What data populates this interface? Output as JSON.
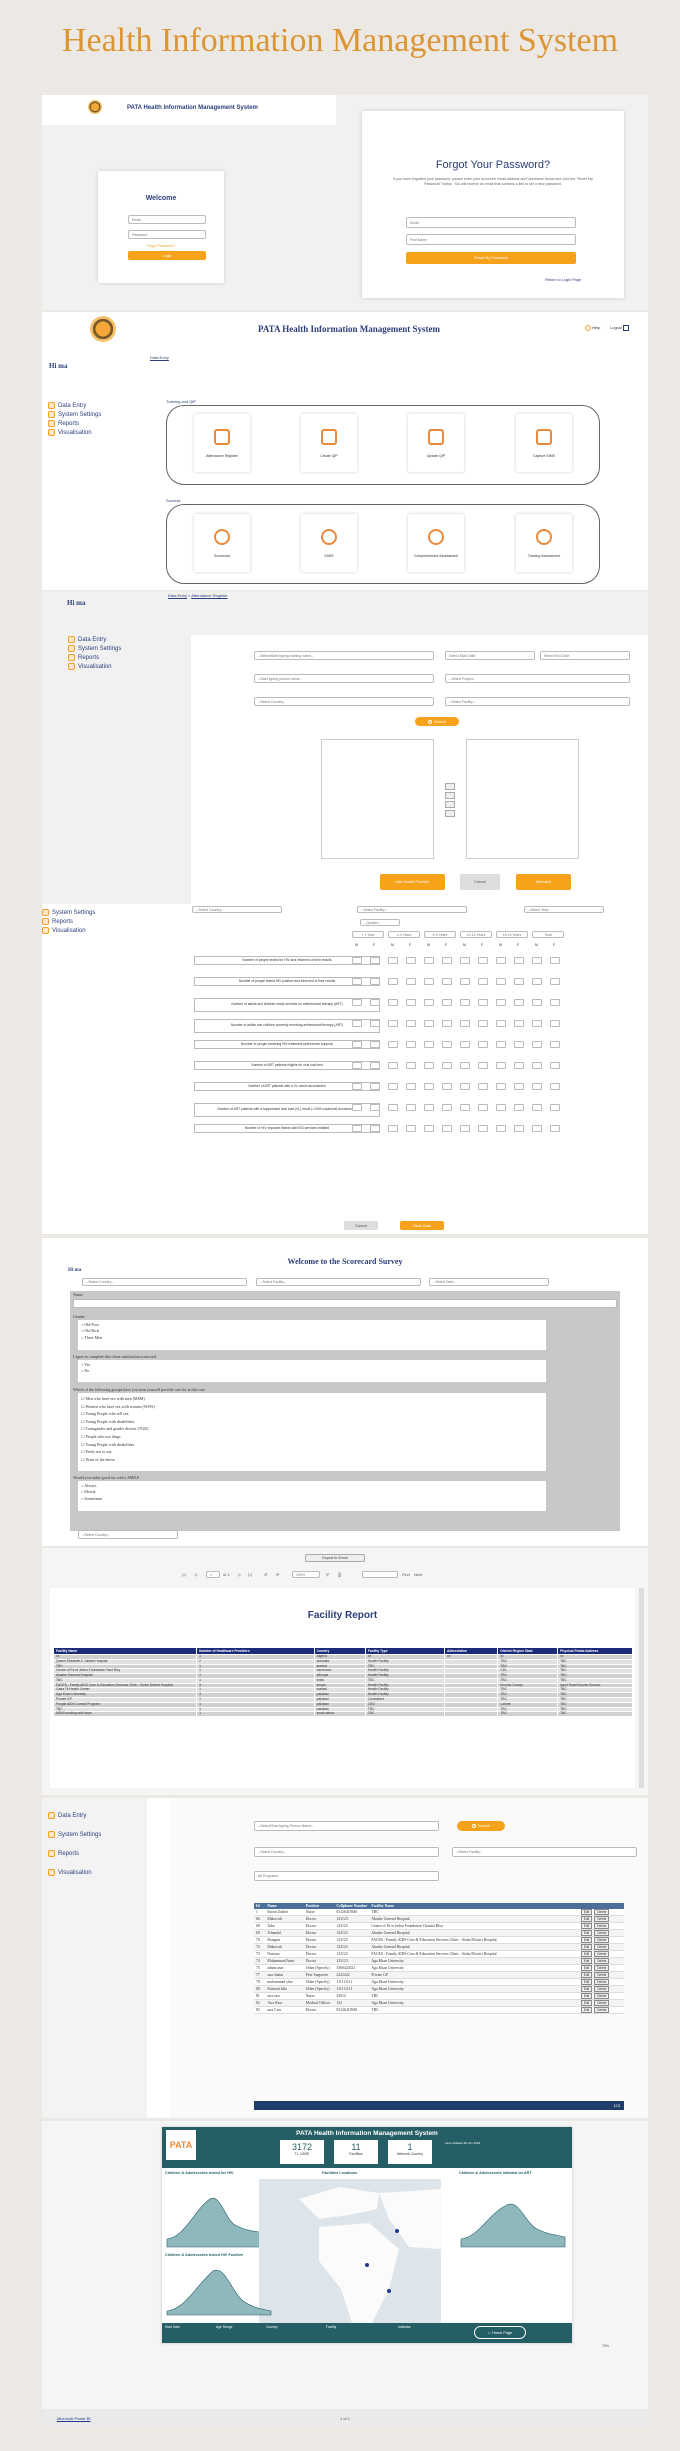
{
  "banner": {
    "title": "Health Information Management System"
  },
  "login": {
    "app_title": "PATA Health Information Management System",
    "welcome": "Welcome",
    "email_placeholder": "Email",
    "password_placeholder": "Password",
    "forgot_link": "Forgot Password?",
    "login_button": "Login"
  },
  "forgot": {
    "title": "Forgot Your Password?",
    "description": "If you have forgotten your password, please enter your account's email address and Username below and click the \"Reset My Password\" button. You will receive an email that contains a link to set a new password.",
    "email_placeholder": "Email",
    "firstname_placeholder": "First Name",
    "reset_button": "Reset My Password",
    "back_link": "Return to Login Page"
  },
  "dashboard": {
    "app_title": "PATA Health Information Management System",
    "greeting": "Hi ma",
    "breadcrumb": "Data Entry",
    "help": "Help",
    "logout": "Logout",
    "section_training": "Training and QIP",
    "section_surveys": "Surveys",
    "tiles_training": [
      "Attendance Register",
      "Create QIP",
      "Update QIP",
      "Capture SIMS"
    ],
    "tiles_surveys": [
      "Scorecard",
      "SARS",
      "Comprehensive Assessment",
      "Training Assessment"
    ]
  },
  "sidebar": {
    "items": [
      "Data Entry",
      "System Settings",
      "Reports",
      "Visualisation"
    ]
  },
  "attendance": {
    "greeting": "Hi ma",
    "breadcrumb_home": "Data Entry",
    "breadcrumb_sep": " > ",
    "breadcrumb_current": "Attendance Register",
    "training_placeholder": "--Select/Start typing training name--",
    "start_date": "Select Start Date",
    "end_date": "Select End Date",
    "hp_placeholder": "--Start typing person name--",
    "project_placeholder": "--Select Project--",
    "country_placeholder": "--Select Country--",
    "facility_placeholder": "--Select Facility--",
    "search_button": "Search",
    "add_button": "Add Health Provider",
    "cancel_button": "Cancel",
    "attended_button": "Attended"
  },
  "sims": {
    "country_placeholder": "--Select Country--",
    "facility_placeholder": "--Select Facility--",
    "year_placeholder": "--Select Year--",
    "quarter_placeholder": "--Quarter--",
    "age_groups": [
      "< 1 Year",
      "1-4 Years",
      "5-9 Years",
      "10-14 Years",
      "15-19 Years",
      "Total"
    ],
    "sexes": [
      "M",
      "F",
      "M",
      "F",
      "M",
      "F",
      "M",
      "F",
      "M",
      "F",
      "M",
      "F"
    ],
    "indicators": [
      "Number of people tested for HIV and informed of their results",
      "Number of people tested HIV positive and informed of their results",
      "Number of adults and children newly enrolled on antiretroviral therapy (ART)",
      "Number of adults and children currently receiving antiretroviral therapy (ART)",
      "Number of people receiving HIV treatment (adherence support)",
      "Number of ART patients eligible for viral load test",
      "Number of ART patients with a VL result documented",
      "Number of ART patients with a suppressed viral load (VL) result (<1000 copies/ml) documented",
      "Number of HIV exposed infants with EID services initiated"
    ],
    "cancel_button": "Cancel",
    "save_button": "Save Data"
  },
  "scorecard": {
    "title": "Welcome to the Scorecard Survey",
    "greeting": "Hi ma",
    "country_placeholder": "--Select Country--",
    "facility_placeholder": "--Select Facility--",
    "date_placeholder": "--Select Date--",
    "q_name": "Name",
    "q_gender": "Gender",
    "gender_options": [
      "Old Poor",
      "Old Rich",
      "Three Men"
    ],
    "q_consent": "I agree to complete this client satisfaction scorecard",
    "consent_options": [
      "Yes",
      "No"
    ],
    "q_groups": "Which of the following groups have you seen yourself provide care for at this care",
    "group_options": [
      "Men who have sex with men (MSM)",
      "Women who have sex with women (WSW)",
      "Young People who sell sex",
      "Young People with disabilities",
      "Transgender and gender diverse (TGD)",
      "People who use drugs",
      "Young People with disabilities",
      "Pretty not to say",
      "None of the above"
    ],
    "q_rating": "Would you rather good ser with a SMILE",
    "rating_options": [
      "Always",
      "Mostly",
      "Sometimes"
    ],
    "country_bottom": "--Select Country--"
  },
  "report": {
    "export_button": "Export to Excel",
    "page_current": "1",
    "page_total": "of 1",
    "zoom": "100%",
    "find_placeholder": "Find",
    "next_label": "Next",
    "title": "Facility Report",
    "columns": [
      "Facility Name",
      "Number of Healthcare Providers",
      "Country",
      "Facility Type",
      "Abbreviation",
      "District Region State",
      "Physical Postal Address"
    ],
    "rows": [
      [
        "xx",
        "1",
        "Algeria",
        "xx",
        "xx",
        "xx",
        "xx"
      ],
      [
        "Queen Elizabeth II Jubilee Hospital",
        "2",
        "australia",
        "Health Facility",
        "",
        "TBC",
        "TBC"
      ],
      [
        "TBC",
        "1",
        "austria",
        "TBC",
        "",
        "TBC",
        "TBC"
      ],
      [
        "Centre of Fa et Jeden Foundation Sant Ricy",
        "1",
        "cameroon",
        "Health Facility",
        "",
        "CDL",
        "TBC"
      ],
      [
        "Akashe General Hospital",
        "1",
        "ethiopia",
        "Health Facility",
        "",
        "TBC",
        "TBC"
      ],
      [
        "TBC",
        "1",
        "india",
        "TBC",
        "",
        "TBC",
        "TBC"
      ],
      [
        "FACES - Family AIDS Care & Education Services Clinic - Sudar District Hospital",
        "3",
        "kenya",
        "Health Facility",
        "",
        "Kisumu County",
        "Agnit Road Kisumu Kisumu"
      ],
      [
        "Gada Tit Health Center",
        "1",
        "malawi",
        "Health Facility",
        "",
        "TBC",
        "TBC"
      ],
      [
        "Aga Khan University",
        "3",
        "pakistan",
        "Health Facility",
        "",
        "TBC",
        "TBC"
      ],
      [
        "Private GP",
        "1",
        "pakistan",
        "Consultant",
        "",
        "TBC",
        "TBC"
      ],
      [
        "Punjab AIDS Control Program",
        "1",
        "pakistan",
        "CBO",
        "",
        "Lahore",
        "TBC"
      ],
      [
        "TBC",
        "1",
        "pakistan",
        "TBC",
        "",
        "TBC",
        "TBC"
      ],
      [
        "MEMI working with boys",
        "1",
        "south africa",
        "TBC",
        "",
        "TBC",
        "TBC"
      ]
    ]
  },
  "providers": {
    "search_placeholder": "--Select/Start typing Person Name--",
    "search_button": "Search",
    "country_placeholder": "--Select Country--",
    "facility_placeholder": "--Select Facility--",
    "programs_placeholder": "All Programs",
    "columns": [
      "Id",
      "Name",
      "Position",
      "Cellphone Number",
      "Facility Name"
    ],
    "edit_label": "Edit",
    "delete_label": "Delete",
    "rows": [
      [
        "1",
        "Farzai Zulfiei",
        "Nurse",
        "03126415940",
        "TBC"
      ],
      [
        "66",
        "Makovuh",
        "Doctor",
        "123123",
        "Akashe General Hospital"
      ],
      [
        "68",
        "Tabo",
        "Doctor",
        "123123",
        "Centre of Fa et Jeden Foundation Chantal Biya"
      ],
      [
        "69",
        "Tshandal",
        "Doctor",
        "123123",
        "Akashe General Hospital"
      ],
      [
        "70",
        "Bongani",
        "Doctor",
        "123123",
        "FACES - Family AIDS Care & Education Services Clinic - Siaha District Hospital"
      ],
      [
        "72",
        "Makovuh",
        "Doctor",
        "123123",
        "Akashe General Hospital"
      ],
      [
        "73",
        "Nasruez",
        "Doctor",
        "123123",
        "FACES - Family AIDS Care & Education Services Clinic - Siaha District Hospital"
      ],
      [
        "74",
        "Muhammad Amir",
        "Doctor",
        "123123",
        "Aga Khan University"
      ],
      [
        "75",
        "adnan asar",
        "Other (Specify)",
        "3360424321",
        "Aga Khan University"
      ],
      [
        "77",
        "sasr shaim",
        "Peer Supporter",
        "2222222",
        "Private GP"
      ],
      [
        "78",
        "muhammad ybiz",
        "Other (Specify)",
        "111111111",
        "Aga Khan University"
      ],
      [
        "80",
        "Fatimah bibi",
        "Other (Specify)",
        "111111111",
        "Aga Khan University"
      ],
      [
        "81",
        "asrs rasr",
        "Nurse",
        "23612",
        "TBC"
      ],
      [
        "82",
        "Asrs Rasr",
        "Medical Officer",
        "123",
        "Aga Khan University"
      ],
      [
        "83",
        "asrs Cres",
        "Doctor",
        "03126415940",
        "TBC"
      ]
    ],
    "page_label": "123"
  },
  "bi": {
    "title": "PATA Health Information Management System",
    "kpis": [
      {
        "value": "3172",
        "label": "TL CARE"
      },
      {
        "value": "11",
        "label": "Facilities"
      },
      {
        "value": "1",
        "label": "Network Country"
      }
    ],
    "last_updated": "Last Updated 30 Jun 2023",
    "chart_titles": [
      "Children & Adolescents tested for HIV",
      "Facilities Locations",
      "Children & Adolescents initiated on ART",
      "Children & Adolescents tested HIV Positive"
    ],
    "filters": [
      "Start Date",
      "Age Range",
      "Country",
      "Facility",
      "Indicator"
    ],
    "home_button": "Home Page",
    "footer_brand": "Microsoft Power BI",
    "footer_page": "1 of 1",
    "zoom": "75%"
  }
}
